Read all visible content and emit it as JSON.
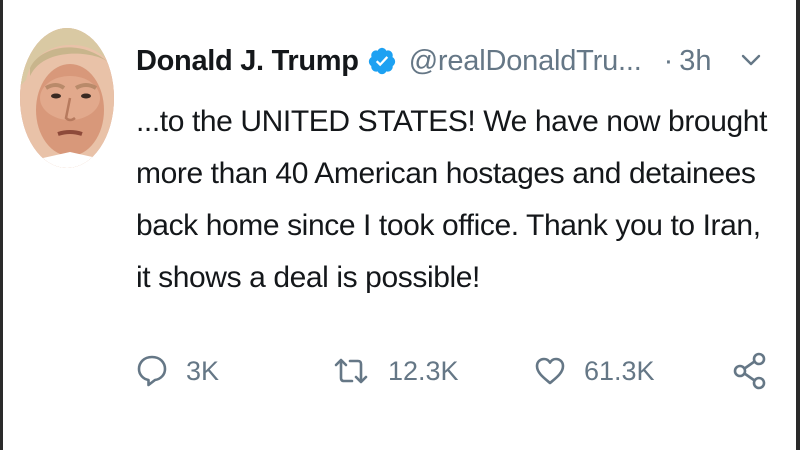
{
  "tweet": {
    "author": {
      "display_name": "Donald J. Trump",
      "handle": "@realDonaldTru...",
      "verified": true,
      "avatar_icon": "profile-photo"
    },
    "separator": "·",
    "time": "3h",
    "text_lines": [
      "...to the UNITED STATES! We have now brought",
      "more than 40 American hostages and detainees",
      "back home since I took office. Thank you to Iran,",
      "it shows a deal is possible!"
    ],
    "actions": {
      "replies": "3K",
      "retweets": "12.3K",
      "likes": "61.3K"
    },
    "icons": {
      "verified": "verified-badge-icon",
      "menu": "chevron-down-icon",
      "reply": "reply-icon",
      "retweet": "retweet-icon",
      "like": "heart-icon",
      "share": "share-icon"
    },
    "colors": {
      "verified_blue": "#1da1f2",
      "text": "#14171a",
      "secondary": "#657786"
    }
  }
}
